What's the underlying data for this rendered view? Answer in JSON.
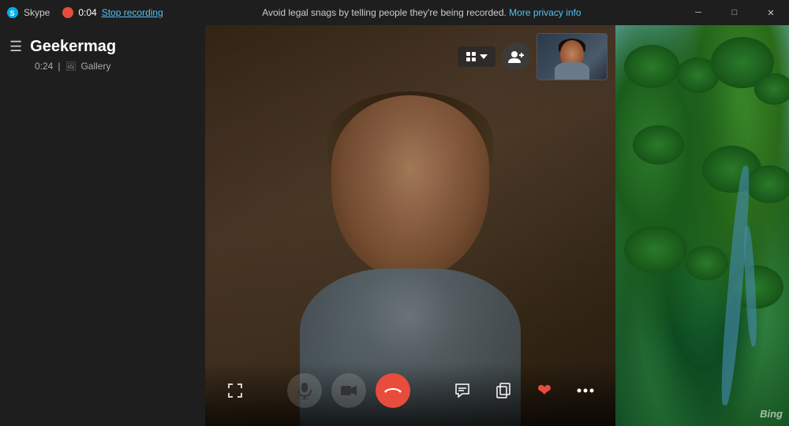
{
  "titlebar": {
    "app_name": "Skype",
    "timer": "0:04",
    "stop_recording_label": "Stop recording",
    "minimize_label": "─",
    "maximize_label": "□",
    "close_label": "✕"
  },
  "notification": {
    "message": "Avoid legal snags by telling people they're being recorded.",
    "link_text": "More privacy info"
  },
  "sidebar": {
    "contact_name": "Geekermag",
    "call_duration": "0:24",
    "gallery_label": "Gallery"
  },
  "controls": {
    "mute_label": "Mute microphone",
    "video_label": "Toggle video",
    "end_call_label": "End call",
    "chat_label": "Chat",
    "copy_label": "Copy",
    "reaction_label": "React",
    "more_label": "More options",
    "expand_label": "Expand",
    "layout_label": "Layout",
    "add_participant_label": "Add participant"
  },
  "watermark": {
    "text": "Bing"
  }
}
